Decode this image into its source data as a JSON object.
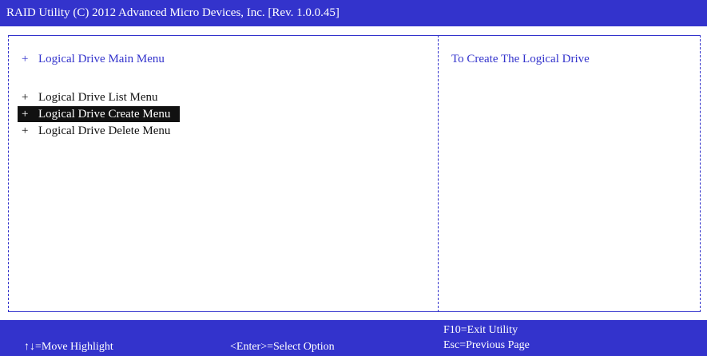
{
  "title_bar": {
    "title": "RAID Utility (C) 2012 Advanced Micro Devices, Inc.   [Rev.  1.0.0.45]"
  },
  "menu": {
    "heading": {
      "prefix": "+",
      "label": "Logical Drive Main Menu"
    },
    "items": [
      {
        "prefix": "+",
        "label": "Logical Drive List Menu",
        "selected": false
      },
      {
        "prefix": "+",
        "label": "Logical Drive Create Menu",
        "selected": true
      },
      {
        "prefix": "+",
        "label": "Logical Drive Delete Menu",
        "selected": false
      }
    ]
  },
  "help": {
    "text": "To Create The Logical Drive"
  },
  "footer": {
    "move_hint": "↑↓=Move Highlight",
    "select_hint": "<Enter>=Select Option",
    "exit_hint": "F10=Exit Utility",
    "back_hint": "Esc=Previous Page"
  },
  "colors": {
    "accent": "#3333cc",
    "selected_bg": "#111111",
    "text": "#111111",
    "background": "#ffffff"
  }
}
